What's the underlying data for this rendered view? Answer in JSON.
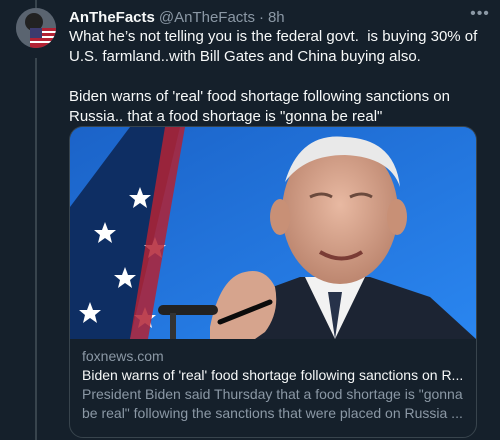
{
  "tweet": {
    "author_name": "AnTheFacts",
    "author_handle": "@AnTheFacts",
    "separator": "·",
    "time": "8h",
    "more_icon": "•••",
    "text": "What he’s not telling you is the federal govt.  is buying 30% of U.S. farmland..with Bill Gates and China buying also.\n\nBiden warns of 'real' food shortage following sanctions on Russia.. that a food shortage is \"gonna be real\""
  },
  "card": {
    "domain": "foxnews.com",
    "title": "Biden warns of 'real' food shortage following sanctions on R...",
    "description": "President Biden said Thursday that a food shortage is \"gonna be real\" following the sanctions that were placed on Russia ..."
  },
  "colors": {
    "background": "#15202b",
    "text_primary": "#f7f9f9",
    "text_secondary": "#8b98a5",
    "border": "#38444d"
  }
}
